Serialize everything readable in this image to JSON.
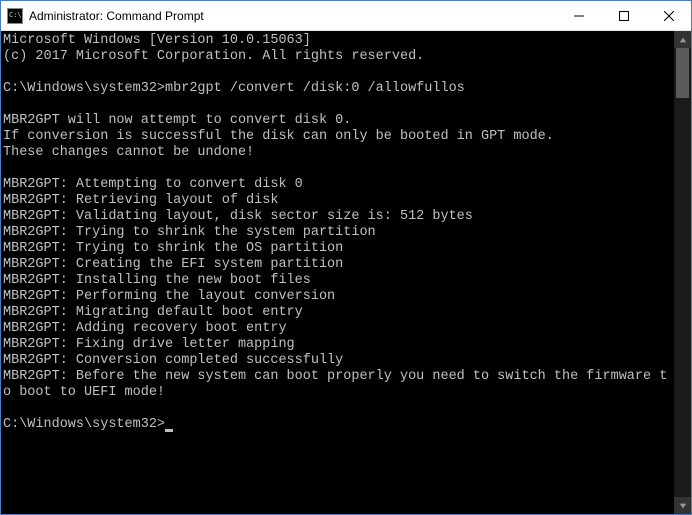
{
  "window": {
    "title": "Administrator: Command Prompt"
  },
  "console": {
    "lines": [
      "Microsoft Windows [Version 10.0.15063]",
      "(c) 2017 Microsoft Corporation. All rights reserved.",
      "",
      "C:\\Windows\\system32>mbr2gpt /convert /disk:0 /allowfullos",
      "",
      "MBR2GPT will now attempt to convert disk 0.",
      "If conversion is successful the disk can only be booted in GPT mode.",
      "These changes cannot be undone!",
      "",
      "MBR2GPT: Attempting to convert disk 0",
      "MBR2GPT: Retrieving layout of disk",
      "MBR2GPT: Validating layout, disk sector size is: 512 bytes",
      "MBR2GPT: Trying to shrink the system partition",
      "MBR2GPT: Trying to shrink the OS partition",
      "MBR2GPT: Creating the EFI system partition",
      "MBR2GPT: Installing the new boot files",
      "MBR2GPT: Performing the layout conversion",
      "MBR2GPT: Migrating default boot entry",
      "MBR2GPT: Adding recovery boot entry",
      "MBR2GPT: Fixing drive letter mapping",
      "MBR2GPT: Conversion completed successfully",
      "MBR2GPT: Before the new system can boot properly you need to switch the firmware to boot to UEFI mode!",
      ""
    ],
    "prompt": "C:\\Windows\\system32>"
  }
}
